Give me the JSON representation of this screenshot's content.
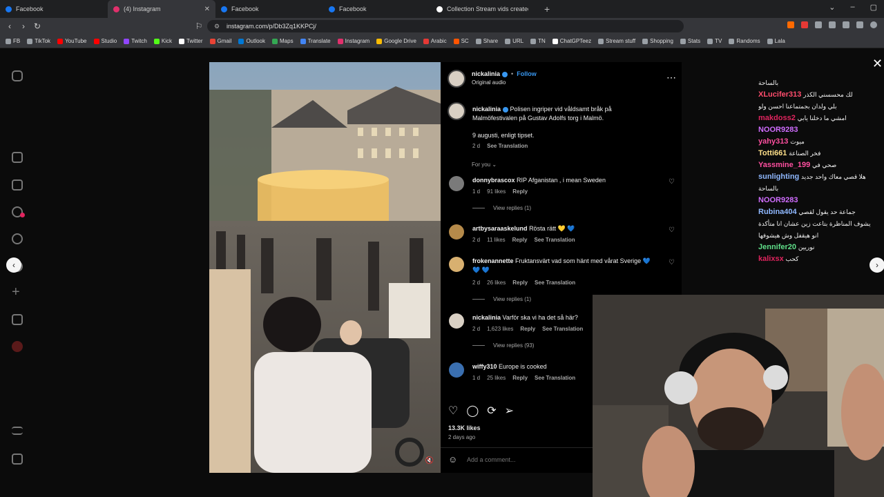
{
  "tabs": [
    {
      "title": "Facebook",
      "color": "#1877f2",
      "active": false
    },
    {
      "title": "(4) Instagram",
      "color": "#e1306c",
      "active": true
    },
    {
      "title": "Facebook",
      "color": "#1877f2",
      "active": false
    },
    {
      "title": "Facebook",
      "color": "#1877f2",
      "active": false
    },
    {
      "title": "Collection Stream vids created by kn",
      "color": "#ffffff",
      "active": false
    }
  ],
  "address": {
    "url": "instagram.com/p/Db3Zq1KKPCj/"
  },
  "bookmarks": [
    {
      "label": "FB",
      "color": "#9aa0a6"
    },
    {
      "label": "TikTok",
      "color": "#9aa0a6"
    },
    {
      "label": "YouTube",
      "color": "#ff0000"
    },
    {
      "label": "Studio",
      "color": "#ff0000"
    },
    {
      "label": "Twitch",
      "color": "#9146ff"
    },
    {
      "label": "Kick",
      "color": "#53fc18"
    },
    {
      "label": "Twitter",
      "color": "#ffffff"
    },
    {
      "label": "Gmail",
      "color": "#ea4335"
    },
    {
      "label": "Outlook",
      "color": "#0078d4"
    },
    {
      "label": "Maps",
      "color": "#34a853"
    },
    {
      "label": "Translate",
      "color": "#4285f4"
    },
    {
      "label": "Instagram",
      "color": "#e1306c"
    },
    {
      "label": "Google Drive",
      "color": "#fbbc04"
    },
    {
      "label": "Arabic",
      "color": "#e53935"
    },
    {
      "label": "SC",
      "color": "#ff5500"
    },
    {
      "label": "Share",
      "color": "#9aa0a6"
    },
    {
      "label": "URL",
      "color": "#9aa0a6"
    },
    {
      "label": "TN",
      "color": "#9aa0a6"
    },
    {
      "label": "ChatGPTeez",
      "color": "#ffffff"
    },
    {
      "label": "Stream stuff",
      "color": "#9aa0a6"
    },
    {
      "label": "Shopping",
      "color": "#9aa0a6"
    },
    {
      "label": "Stats",
      "color": "#9aa0a6"
    },
    {
      "label": "TV",
      "color": "#9aa0a6"
    },
    {
      "label": "Randoms",
      "color": "#9aa0a6"
    },
    {
      "label": "Lala",
      "color": "#9aa0a6"
    }
  ],
  "post": {
    "author": "nickalinia",
    "follow": "Follow",
    "audio": "Original audio",
    "caption_user": "nickalinia",
    "caption": "Polisen ingriper vid våldsamt bråk på Malmöfestivalen på Gustav Adolfs torg i Malmö.",
    "caption2": "9 augusti, enligt tipset.",
    "caption_time": "2 d",
    "see_translation": "See Translation",
    "for_you": "For you",
    "likes": "13.3K likes",
    "posted": "2 days ago",
    "comment_placeholder": "Add a comment..."
  },
  "comments": [
    {
      "user": "donnybrascox",
      "text": "RIP Afganistan , i mean Sweden",
      "time": "1 d",
      "likes": "91 likes",
      "reply": "Reply",
      "translate": "",
      "replies": "View replies (1)"
    },
    {
      "user": "artbysaraaskelund",
      "text": "Rösta rätt 💛 💙",
      "time": "2 d",
      "likes": "11 likes",
      "reply": "Reply",
      "translate": "See Translation",
      "replies": ""
    },
    {
      "user": "frokenannette",
      "text": "Fruktansvärt vad som hänt med vårat Sverige 💙 💙 💙",
      "time": "2 d",
      "likes": "26 likes",
      "reply": "Reply",
      "translate": "See Translation",
      "replies": "View replies (1)"
    },
    {
      "user": "nickalinia",
      "text": "Varför ska vi ha det så här?",
      "time": "2 d",
      "likes": "1,623 likes",
      "reply": "Reply",
      "translate": "See Translation",
      "replies": "View replies (93)"
    },
    {
      "user": "wiffy310",
      "text": "Europe is cooked",
      "time": "1 d",
      "likes": "25 likes",
      "reply": "Reply",
      "translate": "See Translation",
      "replies": ""
    }
  ],
  "chat": [
    {
      "user": "",
      "msg": "بالساحة",
      "color": "#ffffff"
    },
    {
      "user": "XLucifer313",
      "msg": "لك محسسني الكذر",
      "color": "#ff4d6d"
    },
    {
      "user": "",
      "msg": "بلي ولدان بجمتماعنا احسن ولو",
      "color": "#ffffff"
    },
    {
      "user": "makdoss2",
      "msg": "امشي ما دخلنا يابي",
      "color": "#e0245e"
    },
    {
      "user": "NOOR9283",
      "msg": "",
      "color": "#d06dff"
    },
    {
      "user": "yahy313",
      "msg": "ميوت",
      "color": "#ff4fa0"
    },
    {
      "user": "Totti661",
      "msg": "فخر الصناعة",
      "color": "#ffe08a"
    },
    {
      "user": "Yassmine_199",
      "msg": "صحي في",
      "color": "#ff4fa0"
    },
    {
      "user": "sunlighting",
      "msg": "هلا قصي معاك واحد جديد",
      "color": "#8fb8ff"
    },
    {
      "user": "",
      "msg": "بالساحة",
      "color": "#ffffff"
    },
    {
      "user": "NOOR9283",
      "msg": "",
      "color": "#d06dff"
    },
    {
      "user": "Rubina404",
      "msg": "جماعة حد يقول لقصي",
      "color": "#8fb8ff"
    },
    {
      "user": "",
      "msg": "يشوف المناظرة بتاعت زين عشان انا متأكدة",
      "color": "#ffffff"
    },
    {
      "user": "",
      "msg": "انو هيقفل وش هيشوفها",
      "color": "#ffffff"
    },
    {
      "user": "Jennifer20",
      "msg": "نوريين",
      "color": "#60e08a"
    },
    {
      "user": "kalixsx",
      "msg": "كحب",
      "color": "#e0245e"
    }
  ]
}
